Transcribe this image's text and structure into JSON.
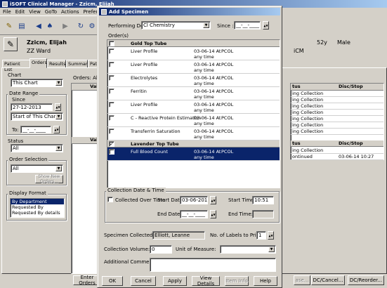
{
  "main_window": {
    "title": "iSOFT Clinical Manager - Zzicm, Elijah",
    "menu": [
      "File",
      "Edit",
      "View",
      "GoTo",
      "Actions",
      "Preference"
    ],
    "patient": {
      "name": "Zzicm, Elijah",
      "ward": "ZZ Ward",
      "age": "52y",
      "sex": "Male",
      "location": "iCM"
    },
    "tabs": [
      "Patient List",
      "Orders",
      "Results",
      "Summary",
      "Pati"
    ],
    "active_tab": "Orders",
    "sidebar": {
      "chart_label": "Chart",
      "chart_value": "This Chart",
      "date_range_label": "Date Range",
      "since_label": "Since",
      "since_date": "27-12-2013",
      "since_option": "Start of This Chart",
      "to_label": "To:",
      "to_value": "__-__-____",
      "status_label": "Status",
      "status_value": "All",
      "order_selection_label": "Order Selection",
      "order_selection_value": "All",
      "show_new_orders": "Show New Orders...",
      "display_format_label": "Display Format",
      "display_format_options": [
        "By Department",
        "Requested By",
        "Requested By details"
      ]
    },
    "orders_list": {
      "label": "Orders: All",
      "col_value": "Valu",
      "col_status": "tus",
      "col_disc": "Disc/Stop",
      "status_rows": [
        {
          "status": "ing Collection",
          "disc": ""
        },
        {
          "status": "ing Collection",
          "disc": ""
        },
        {
          "status": "ing Collection",
          "disc": ""
        },
        {
          "status": "ing Collection",
          "disc": ""
        },
        {
          "status": "ing Collection",
          "disc": ""
        },
        {
          "status": "ing Collection",
          "disc": ""
        },
        {
          "status": "ing Collection",
          "disc": ""
        }
      ],
      "status_rows2": [
        {
          "status": "ing Collection",
          "disc": ""
        },
        {
          "status": "ontinued",
          "disc": "03-06-14 10:27"
        }
      ]
    },
    "bottom_buttons": {
      "enter_orders": "Enter Orders",
      "abandon": "ase...",
      "dc_cancel": "DC/Cancel...",
      "dc_reorder": "DC/Reorder..."
    }
  },
  "dialog": {
    "title": "Add Specimen",
    "performing_dept_label": "Performing Dept.",
    "performing_dept_value": "Cl Chemistry",
    "since_label": "Since :",
    "since_value": "__-__-____",
    "orders_label": "Order(s)",
    "groups": [
      {
        "name": "Gold Top Tube",
        "items": [
          {
            "name": "Liver Profile",
            "date": "03-06-14 At",
            "when": "any time",
            "code": "PCOL"
          },
          {
            "name": "Liver Profile",
            "date": "03-06-14 At",
            "when": "any time",
            "code": "PCOL"
          },
          {
            "name": "Electrolytes",
            "date": "03-06-14 At",
            "when": "any time",
            "code": "PCOL"
          },
          {
            "name": "Ferritin",
            "date": "03-06-14 At",
            "when": "any time",
            "code": "PCOL"
          },
          {
            "name": "Liver Profile",
            "date": "03-06-14 At",
            "when": "any time",
            "code": "PCOL"
          },
          {
            "name": "C - Reactive Protein Estimation",
            "date": "03-06-14 At",
            "when": "any time",
            "code": "PCOL"
          },
          {
            "name": "Transferrin Saturation",
            "date": "03-06-14 At",
            "when": "any time",
            "code": "PCOL"
          }
        ]
      },
      {
        "name": "Lavender Top Tube",
        "items": [
          {
            "name": "Full Blood Count",
            "date": "03-06-14 At",
            "when": "any time",
            "code": "PCOL"
          }
        ]
      }
    ],
    "collection": {
      "group_label": "Collection Date & Time",
      "collected_over_time": "Collected Over Time",
      "start_date_label": "Start Date:",
      "start_date": "03-06-2014",
      "start_time_label": "Start Time:",
      "start_time": "10:51",
      "end_date_label": "End Date:",
      "end_date": "__-__-____",
      "end_time_label": "End Time:",
      "end_time": ""
    },
    "specimen_collected_by_label": "Specimen Collected by:",
    "specimen_collected_by": "Elliott, Leanne",
    "labels_to_print_label": "No. of Labels to Print:",
    "labels_to_print": "1",
    "collection_volume_label": "Collection Volume:",
    "collection_volume": "0",
    "unit_label": "Unit of Measure:",
    "unit_value": "",
    "comments_label": "Additional Comments:",
    "comments_value": "",
    "buttons": {
      "ok": "OK",
      "cancel": "Cancel",
      "apply": "Apply",
      "view_details": "View Details",
      "item_info": "Item Info",
      "help": "Help"
    }
  }
}
